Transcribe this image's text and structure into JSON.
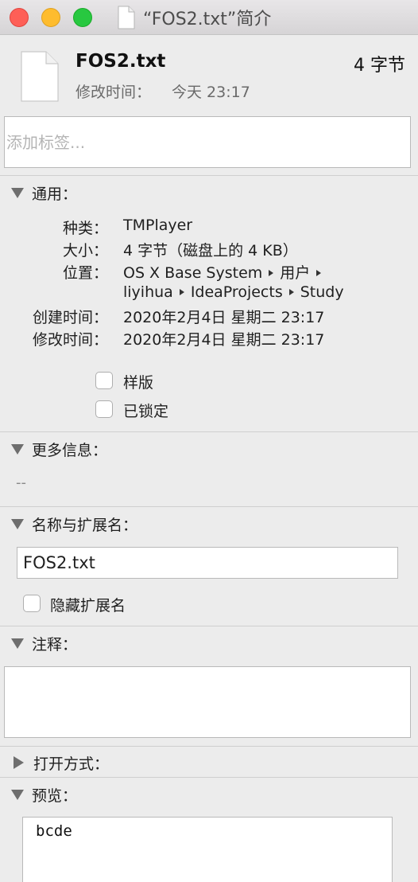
{
  "window": {
    "title": "“FOS2.txt”简介"
  },
  "header": {
    "file_name": "FOS2.txt",
    "file_size": "4 字节",
    "modified_label": "修改时间：",
    "modified_value": "今天 23:17",
    "icon": "document-icon"
  },
  "tags": {
    "placeholder": "添加标签..."
  },
  "general": {
    "title": "通用：",
    "kind_label": "种类：",
    "kind_value": "TMPlayer",
    "size_label": "大小：",
    "size_value": "4 字节（磁盘上的 4 KB）",
    "where_label": "位置：",
    "where_path": [
      "OS X Base System",
      "用户",
      "liyihua",
      "IdeaProjects",
      "Study"
    ],
    "created_label": "创建时间：",
    "created_value": "2020年2月4日 星期二 23:17",
    "modified_label": "修改时间：",
    "modified_value": "2020年2月4日 星期二 23:17",
    "stationery_label": "样版",
    "locked_label": "已锁定"
  },
  "more_info": {
    "title": "更多信息：",
    "value": "--"
  },
  "name_extension": {
    "title": "名称与扩展名：",
    "value": "FOS2.txt",
    "hide_extension_label": "隐藏扩展名"
  },
  "comments": {
    "title": "注释：",
    "value": ""
  },
  "open_with": {
    "title": "打开方式："
  },
  "preview": {
    "title": "预览：",
    "content": "bcde"
  }
}
